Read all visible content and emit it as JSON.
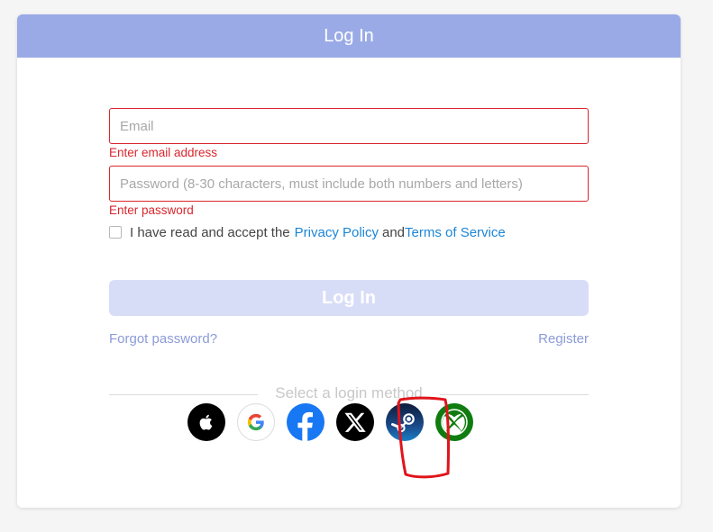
{
  "header": {
    "title": "Log In"
  },
  "form": {
    "email": {
      "placeholder": "Email",
      "value": "",
      "error": "Enter email address"
    },
    "password": {
      "placeholder": "Password (8-30 characters, must include both numbers and letters)",
      "value": "",
      "error": "Enter password"
    },
    "agreement": {
      "checked": false,
      "text_prefix": "I have read and accept the",
      "privacy_link": "Privacy Policy",
      "conjunction": "and",
      "terms_link": "Terms of Service"
    },
    "submit_label": "Log In",
    "forgot_label": "Forgot password?",
    "register_label": "Register"
  },
  "login_methods": {
    "divider_text": "Select a login method",
    "providers": [
      {
        "name": "Apple",
        "icon": "apple-icon"
      },
      {
        "name": "Google",
        "icon": "google-icon"
      },
      {
        "name": "Facebook",
        "icon": "facebook-icon"
      },
      {
        "name": "X",
        "icon": "x-icon"
      },
      {
        "name": "Steam",
        "icon": "steam-icon",
        "highlighted": true
      },
      {
        "name": "Xbox",
        "icon": "xbox-icon"
      }
    ]
  },
  "colors": {
    "header_bg": "#9aaae6",
    "error": "#d9262c",
    "link": "#1c86d6",
    "secondary_link": "#8c9bd8",
    "disabled_button": "#d8ddf7",
    "annotation": "#e0141a"
  }
}
